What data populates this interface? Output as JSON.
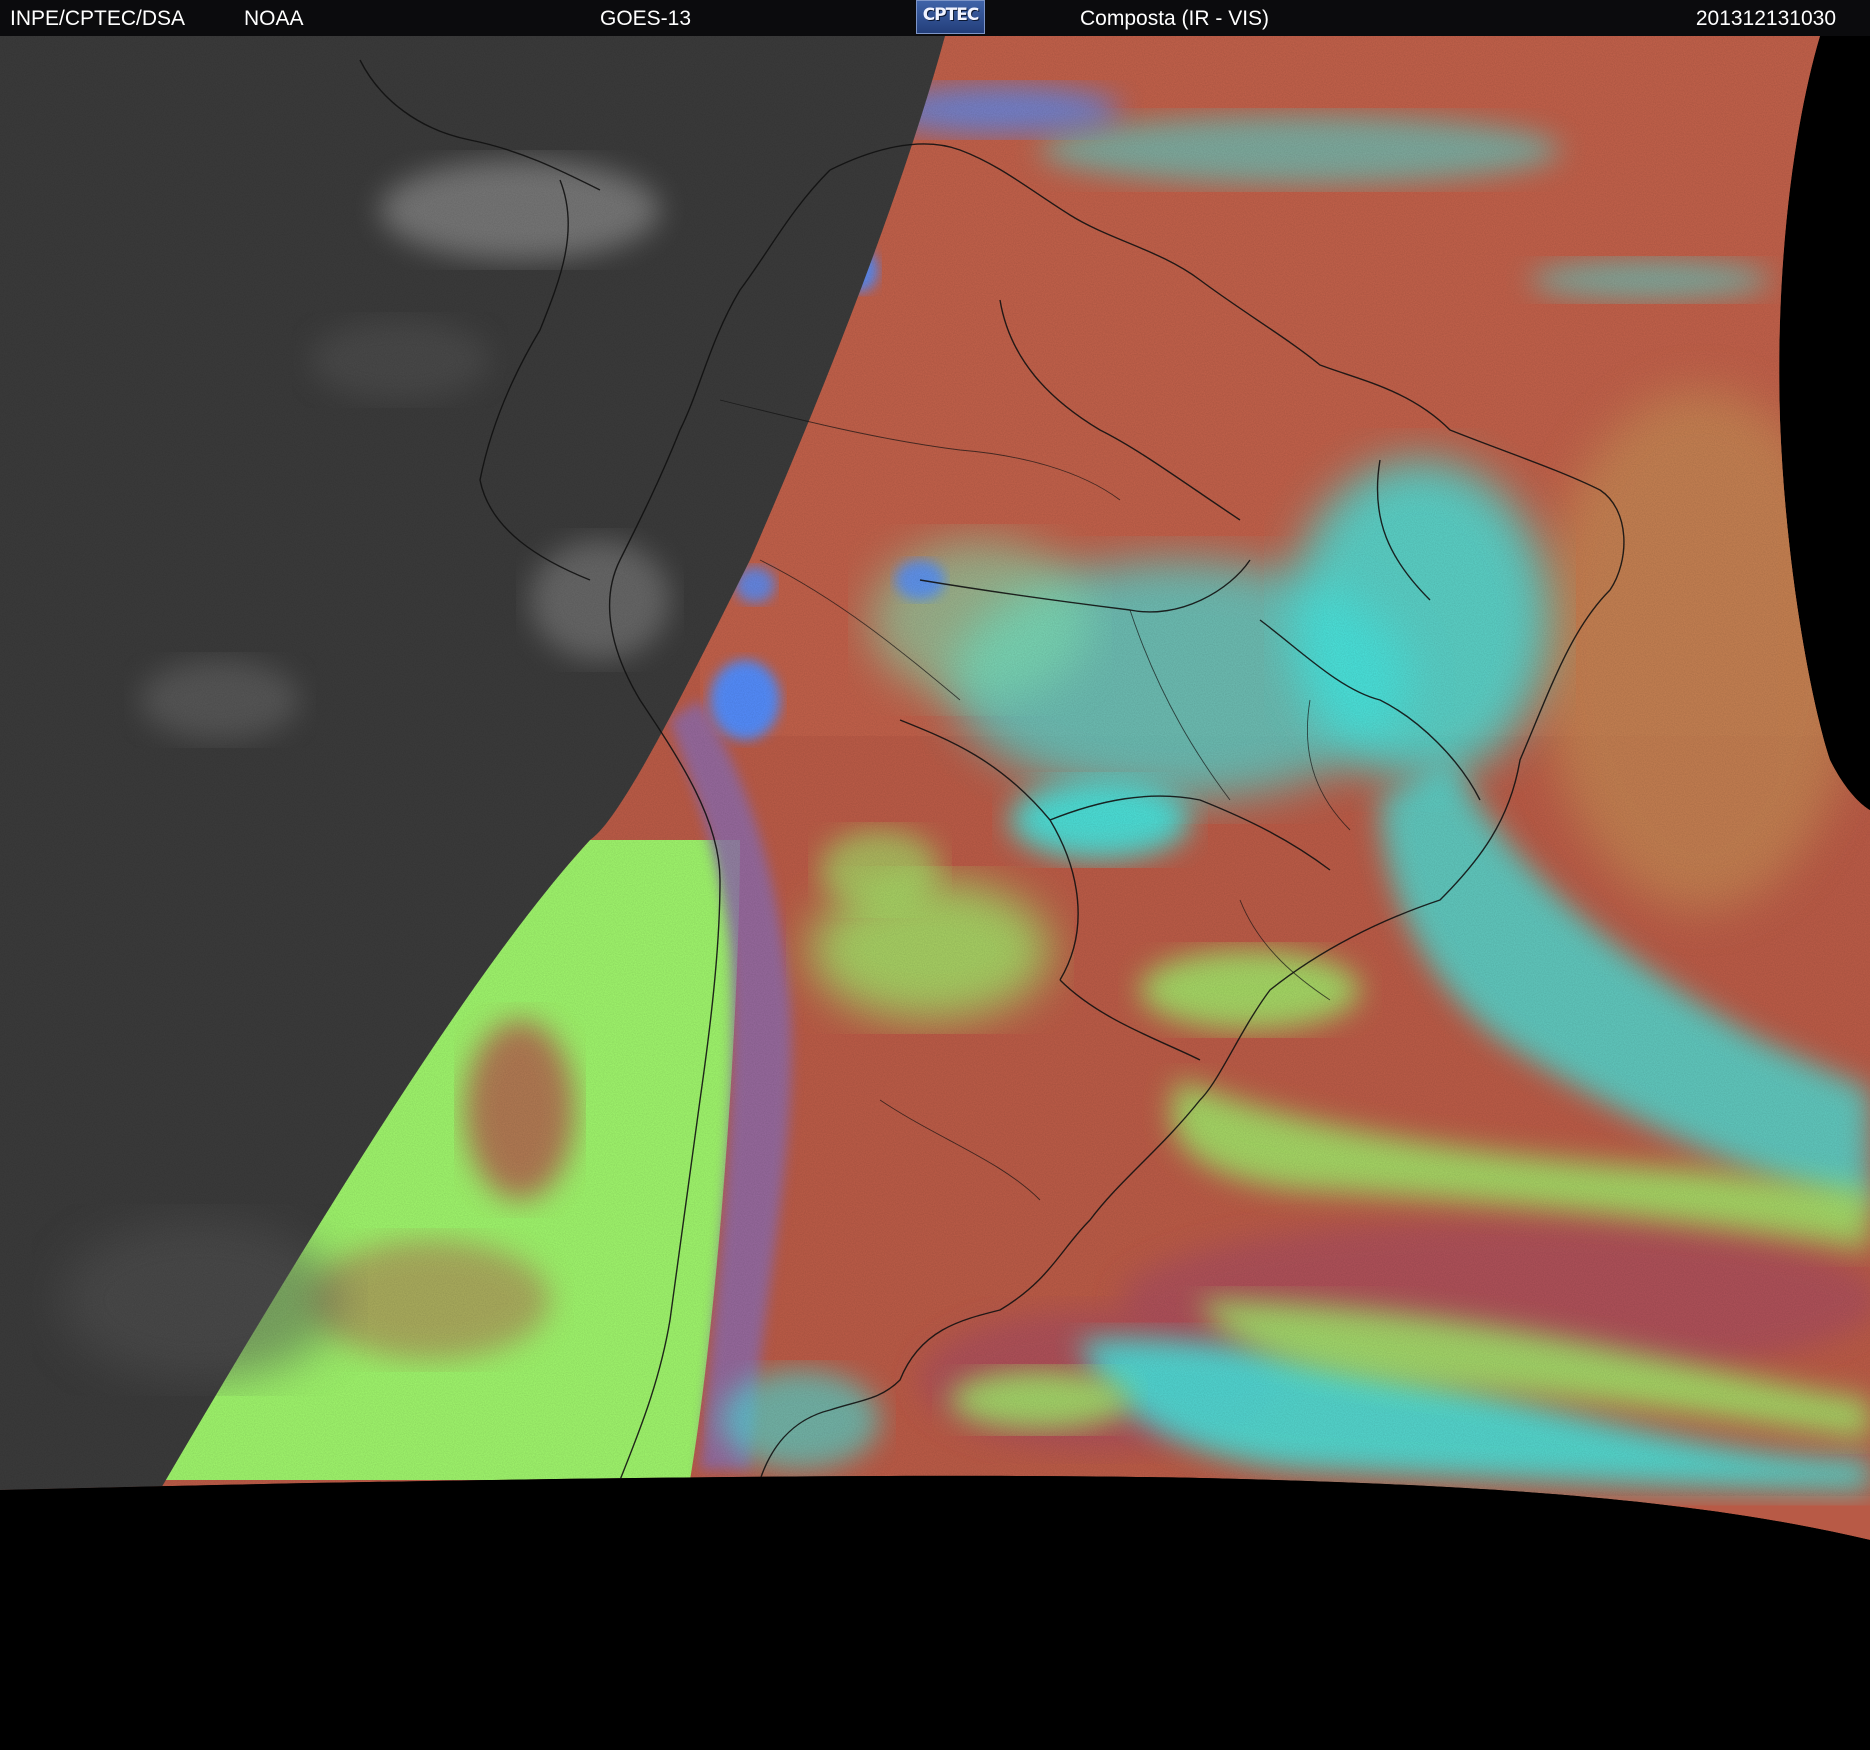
{
  "header": {
    "agency": "INPE/CPTEC/DSA",
    "source": "NOAA",
    "satellite": "GOES-13",
    "logo_text": "CPTEC",
    "product": "Composta (IR - VIS)",
    "timestamp": "201312131030"
  },
  "colors": {
    "header_background": "#0b0b0d",
    "header_text": "#ffffff",
    "night_ir_gray": "#3a3a3a",
    "clear_sky_red": "#b85a46",
    "low_cloud_green": "#9cf06a",
    "high_cloud_cyan": "#3fe6e0",
    "deep_convection_blue": "#4d8cff",
    "outside_disk": "#000000"
  },
  "icons": {
    "logo": "cptec-logo-icon"
  }
}
